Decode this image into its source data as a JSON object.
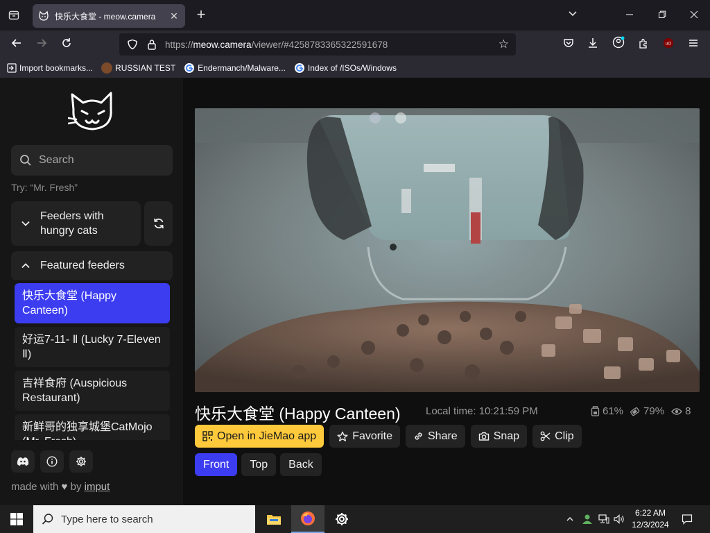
{
  "browser": {
    "tab_title": "快乐大食堂 - meow.camera",
    "url_prefix": "https://",
    "url_host": "meow.camera",
    "url_path": "/viewer/#4258783365322591678",
    "bookmarks": [
      {
        "label": "Import bookmarks...",
        "color": "#2b2a33"
      },
      {
        "label": "RUSSIAN TEST",
        "color": "#7a4a2a"
      },
      {
        "label": "Endermanch/Malware...",
        "color": "#eeeeee"
      },
      {
        "label": "Index of /ISOs/Windows",
        "color": "#4285f4"
      }
    ]
  },
  "sidebar": {
    "search_placeholder": "Search",
    "hint": "Try: “Mr. Fresh”",
    "group_hungry": "Feeders with hungry cats",
    "group_featured": "Featured feeders",
    "feeders": [
      {
        "label": "快乐大食堂 (Happy Canteen)",
        "active": true
      },
      {
        "label": "好运7-11- Ⅱ (Lucky 7-Eleven Ⅱ)",
        "active": false
      },
      {
        "label": "吉祥食府 (Auspicious Restaurant)",
        "active": false
      },
      {
        "label": "新鲜哥的独享城堡CatMojo (Mr. Fresh)",
        "active": false
      }
    ],
    "made_with": "made with",
    "by": "by",
    "author": "imput"
  },
  "viewer": {
    "title": "快乐大食堂 (Happy Canteen)",
    "local_time": "Local time: 10:21:59 PM",
    "stats": {
      "food": "61%",
      "battery": "79%",
      "viewers": "8"
    },
    "actions": {
      "open_app": "Open in JieMao app",
      "favorite": "Favorite",
      "share": "Share",
      "snap": "Snap",
      "clip": "Clip"
    },
    "views": [
      "Front",
      "Top",
      "Back"
    ],
    "active_view": "Front"
  },
  "taskbar": {
    "search_placeholder": "Type here to search",
    "time": "6:22 AM",
    "date": "12/3/2024"
  },
  "colors": {
    "accent": "#3c3cf0",
    "primary_action": "#ffc93c"
  }
}
